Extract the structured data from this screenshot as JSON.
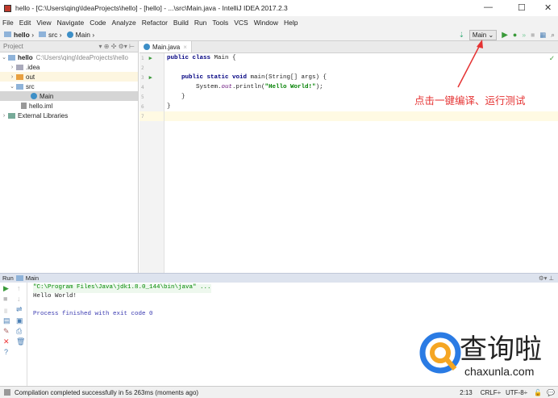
{
  "window": {
    "title": "hello - [C:\\Users\\qing\\IdeaProjects\\hello] - [hello] - ...\\src\\Main.java - IntelliJ IDEA 2017.2.3",
    "minimize": "—",
    "maximize": "☐",
    "close": "✕"
  },
  "menu": [
    "File",
    "Edit",
    "View",
    "Navigate",
    "Code",
    "Analyze",
    "Refactor",
    "Build",
    "Run",
    "Tools",
    "VCS",
    "Window",
    "Help"
  ],
  "breadcrumb": [
    "hello",
    "src",
    "Main"
  ],
  "toolbar": {
    "run_config": "Main"
  },
  "project": {
    "header": "Project",
    "tree": [
      {
        "label": "hello",
        "path": "C:\\Users\\qing\\IdeaProjects\\hello"
      },
      {
        "label": ".idea"
      },
      {
        "label": "out"
      },
      {
        "label": "src"
      },
      {
        "label": "Main"
      },
      {
        "label": "hello.iml"
      },
      {
        "label": "External Libraries"
      }
    ]
  },
  "editor": {
    "tab": "Main.java",
    "lines": [
      "1",
      "2",
      "3",
      "4",
      "5",
      "6",
      "7"
    ],
    "code": {
      "l1a": "public class ",
      "l1b": "Main {",
      "l3a": "    public static void ",
      "l3b": "main(String[] args) {",
      "l4a": "        System.",
      "l4b": "out",
      "l4c": ".println(",
      "l4d": "\"Hello World!\"",
      "l4e": ");",
      "l5": "    }",
      "l6": "}"
    }
  },
  "annotation": "点击一键编译、运行测试",
  "run": {
    "label": "Run",
    "config": "Main",
    "output": [
      "\"C:\\Program Files\\Java\\jdk1.8.0_144\\bin\\java\" ...",
      "Hello World!",
      "",
      "Process finished with exit code 0"
    ]
  },
  "status": {
    "message": "Compilation completed successfully in 5s 263ms (moments ago)",
    "position": "2:13",
    "line_sep": "CRLF÷",
    "encoding": "UTF-8÷"
  },
  "watermark": {
    "text": "查询啦",
    "url": "chaxunla.com"
  },
  "colors": {
    "annotation": "#e53333",
    "run_green": "#3a9a3a"
  }
}
